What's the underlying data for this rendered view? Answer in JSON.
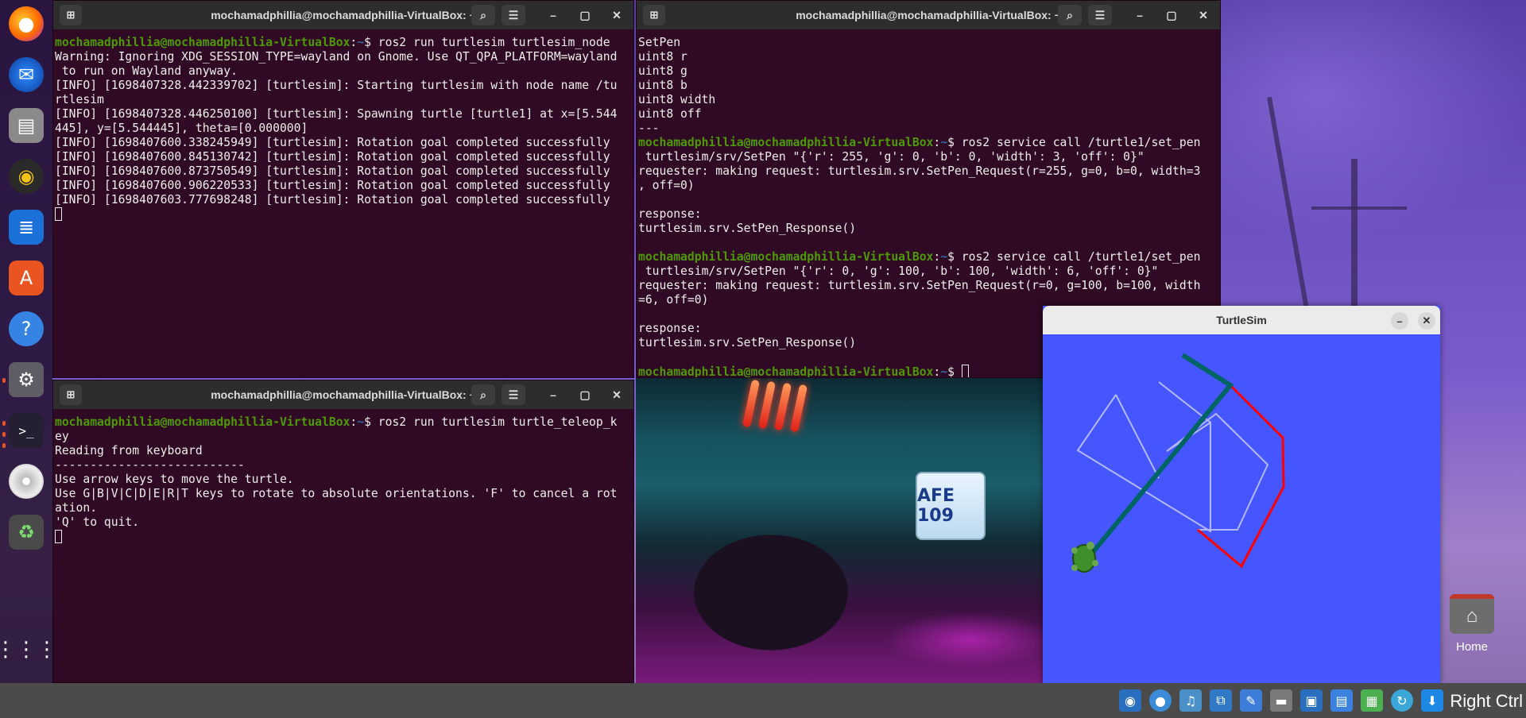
{
  "terminals": {
    "top_left": {
      "title": "mochamadphillia@mochamadphillia-VirtualBox: ~",
      "lines": [
        {
          "user": "mochamadphillia@mochamadphillia-VirtualBox",
          "path": "~",
          "text": "$ ros2 run turtlesim turtlesim_node"
        },
        {
          "text": "Warning: Ignoring XDG_SESSION_TYPE=wayland on Gnome. Use QT_QPA_PLATFORM=wayland"
        },
        {
          "text": " to run on Wayland anyway."
        },
        {
          "text": "[INFO] [1698407328.442339702] [turtlesim]: Starting turtlesim with node name /tu"
        },
        {
          "text": "rtlesim"
        },
        {
          "text": "[INFO] [1698407328.446250100] [turtlesim]: Spawning turtle [turtle1] at x=[5.544"
        },
        {
          "text": "445], y=[5.544445], theta=[0.000000]"
        },
        {
          "text": "[INFO] [1698407600.338245949] [turtlesim]: Rotation goal completed successfully"
        },
        {
          "text": "[INFO] [1698407600.845130742] [turtlesim]: Rotation goal completed successfully"
        },
        {
          "text": "[INFO] [1698407600.873750549] [turtlesim]: Rotation goal completed successfully"
        },
        {
          "text": "[INFO] [1698407600.906220533] [turtlesim]: Rotation goal completed successfully"
        },
        {
          "text": "[INFO] [1698407603.777698248] [turtlesim]: Rotation goal completed successfully"
        },
        {
          "cursor": true,
          "text": ""
        }
      ]
    },
    "top_right": {
      "title": "mochamadphillia@mochamadphillia-VirtualBox: ~",
      "lines": [
        {
          "text": "SetPen"
        },
        {
          "text": "uint8 r"
        },
        {
          "text": "uint8 g"
        },
        {
          "text": "uint8 b"
        },
        {
          "text": "uint8 width"
        },
        {
          "text": "uint8 off"
        },
        {
          "text": "---"
        },
        {
          "user": "mochamadphillia@mochamadphillia-VirtualBox",
          "path": "~",
          "text": "$ ros2 service call /turtle1/set_pen"
        },
        {
          "text": " turtlesim/srv/SetPen \"{'r': 255, 'g': 0, 'b': 0, 'width': 3, 'off': 0}\""
        },
        {
          "text": "requester: making request: turtlesim.srv.SetPen_Request(r=255, g=0, b=0, width=3"
        },
        {
          "text": ", off=0)"
        },
        {
          "text": ""
        },
        {
          "text": "response:"
        },
        {
          "text": "turtlesim.srv.SetPen_Response()"
        },
        {
          "text": ""
        },
        {
          "user": "mochamadphillia@mochamadphillia-VirtualBox",
          "path": "~",
          "text": "$ ros2 service call /turtle1/set_pen"
        },
        {
          "text": " turtlesim/srv/SetPen \"{'r': 0, 'g': 100, 'b': 100, 'width': 6, 'off': 0}\""
        },
        {
          "text": "requester: making request: turtlesim.srv.SetPen_Request(r=0, g=100, b=100, width"
        },
        {
          "text": "=6, off=0)"
        },
        {
          "text": ""
        },
        {
          "text": "response:"
        },
        {
          "text": "turtlesim.srv.SetPen_Response()"
        },
        {
          "text": ""
        },
        {
          "user": "mochamadphillia@mochamadphillia-VirtualBox",
          "path": "~",
          "text": "$ ",
          "cursor": true
        }
      ]
    },
    "bottom_left": {
      "title": "mochamadphillia@mochamadphillia-VirtualBox: ~",
      "lines": [
        {
          "user": "mochamadphillia@mochamadphillia-VirtualBox",
          "path": "~",
          "text": "$ ros2 run turtlesim turtle_teleop_k"
        },
        {
          "text": "ey"
        },
        {
          "text": "Reading from keyboard"
        },
        {
          "text": "---------------------------"
        },
        {
          "text": "Use arrow keys to move the turtle."
        },
        {
          "text": "Use G|B|V|C|D|E|R|T keys to rotate to absolute orientations. 'F' to cancel a rot"
        },
        {
          "text": "ation."
        },
        {
          "text": "'Q' to quit."
        },
        {
          "cursor": true,
          "text": ""
        }
      ]
    }
  },
  "turtlesim": {
    "title": "TurtleSim",
    "background": "#4556ff",
    "pen_colors": {
      "red": "#ff0000",
      "teal": "#006464",
      "default": "#b3b8ff"
    }
  },
  "photo": {
    "plate_text": "AFE 109"
  },
  "desktop": {
    "home_label": "Home"
  },
  "dock": {
    "icons": [
      "firefox-icon",
      "thunderbird-icon",
      "files-icon",
      "rhythmbox-icon",
      "writer-icon",
      "app-center-icon",
      "help-icon",
      "settings-icon",
      "terminal-icon",
      "disc-icon",
      "trash-icon",
      "show-apps-icon"
    ]
  },
  "statusbar": {
    "host_key": "Right Ctrl"
  }
}
